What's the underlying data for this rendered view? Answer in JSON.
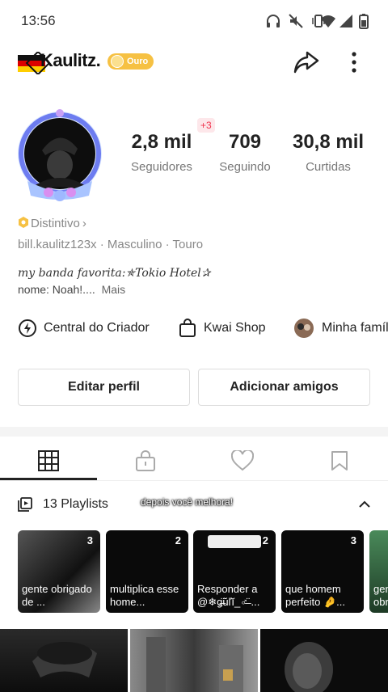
{
  "status_bar": {
    "time": "13:56"
  },
  "header": {
    "username": "Kaulitz.",
    "badge": "Ouro"
  },
  "stats": {
    "followers": {
      "value": "2,8 mil",
      "label": "Seguidores",
      "delta": "+3"
    },
    "following": {
      "value": "709",
      "label": "Seguindo"
    },
    "likes": {
      "value": "30,8 mil",
      "label": "Curtidas"
    }
  },
  "profile": {
    "distintivo": "Distintivo",
    "handle": "bill.kaulitz123x",
    "gender": "Masculino",
    "zodiac": "Touro",
    "bio_line1": "my banda favorita:✯Tokio Hotel✰",
    "bio_line2": "nome: Noah!....",
    "more": "Mais"
  },
  "shortcuts": [
    {
      "label": "Central do Criador",
      "icon": "creator-icon"
    },
    {
      "label": "Kwai Shop",
      "icon": "shop-bag-icon"
    },
    {
      "label": "Minha família",
      "icon": "family-avatar-icon"
    }
  ],
  "buttons": {
    "edit": "Editar perfil",
    "add_friends": "Adicionar amigos"
  },
  "tabs": [
    {
      "icon": "grid-icon",
      "active": true
    },
    {
      "icon": "lock-icon",
      "active": false
    },
    {
      "icon": "heart-icon",
      "active": false
    },
    {
      "icon": "bookmark-icon",
      "active": false
    }
  ],
  "playlists": {
    "title": "13 Playlists",
    "overlay": "depois você melhora!",
    "items": [
      {
        "count": "3",
        "caption": "gente obrigado de ..."
      },
      {
        "count": "2",
        "caption": "multiplica esse home..."
      },
      {
        "count": "2",
        "caption": "Responder a @❄ǥ̶̈ŭľĭ_♂̶̈ ..."
      },
      {
        "count": "3",
        "caption": "que homem perfeito 🤌..."
      },
      {
        "count": "",
        "caption": "gen obr"
      }
    ]
  },
  "colors": {
    "accent_red": "#f0344e",
    "gold": "#f6c143",
    "text_dark": "#222222",
    "text_grey": "#888888"
  }
}
